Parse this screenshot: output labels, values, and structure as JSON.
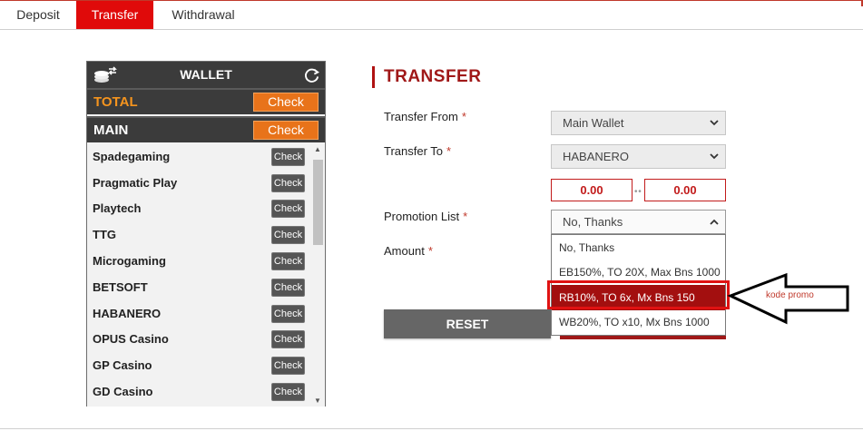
{
  "tabs": [
    {
      "label": "Deposit",
      "active": false
    },
    {
      "label": "Transfer",
      "active": true
    },
    {
      "label": "Withdrawal",
      "active": false
    }
  ],
  "wallet": {
    "title": "WALLET",
    "total": {
      "label": "TOTAL",
      "button": "Check",
      "color": "#f5941e"
    },
    "main": {
      "label": "MAIN",
      "button": "Check",
      "color": "#ffffff"
    },
    "providers": [
      {
        "name": "Spadegaming",
        "button": "Check"
      },
      {
        "name": "Pragmatic Play",
        "button": "Check"
      },
      {
        "name": "Playtech",
        "button": "Check"
      },
      {
        "name": "TTG",
        "button": "Check"
      },
      {
        "name": "Microgaming",
        "button": "Check"
      },
      {
        "name": "BETSOFT",
        "button": "Check"
      },
      {
        "name": "HABANERO",
        "button": "Check"
      },
      {
        "name": "OPUS Casino",
        "button": "Check"
      },
      {
        "name": "GP Casino",
        "button": "Check"
      },
      {
        "name": "GD Casino",
        "button": "Check"
      }
    ]
  },
  "transfer": {
    "title": "TRANSFER",
    "from_label": "Transfer From",
    "from_value": "Main Wallet",
    "to_label": "Transfer To",
    "to_value": "HABANERO",
    "balance_from": "0.00",
    "balance_to": "0.00",
    "promo_label": "Promotion List",
    "promo_value": "No, Thanks",
    "amount_label": "Amount",
    "required_mark": "*",
    "reset_label": "RESET",
    "promo_options": [
      {
        "label": "No, Thanks",
        "selected": false
      },
      {
        "label": "EB150%, TO 20X, Max Bns 1000",
        "selected": false
      },
      {
        "label": "RB10%, TO 6x, Mx Bns 150",
        "selected": true
      },
      {
        "label": "WB20%, TO x10, Mx Bns 1000",
        "selected": false
      }
    ]
  },
  "annotation": {
    "text": "kode promo",
    "color": "#e01212"
  },
  "colors": {
    "accent": "#e00a0a",
    "title": "#a01818",
    "wallet_bg": "#3b3b3b",
    "check_orange": "#e8731a"
  },
  "icons": {
    "coins": "coins-icon",
    "refresh": "refresh-icon",
    "chevron": "chevron-down-icon"
  }
}
